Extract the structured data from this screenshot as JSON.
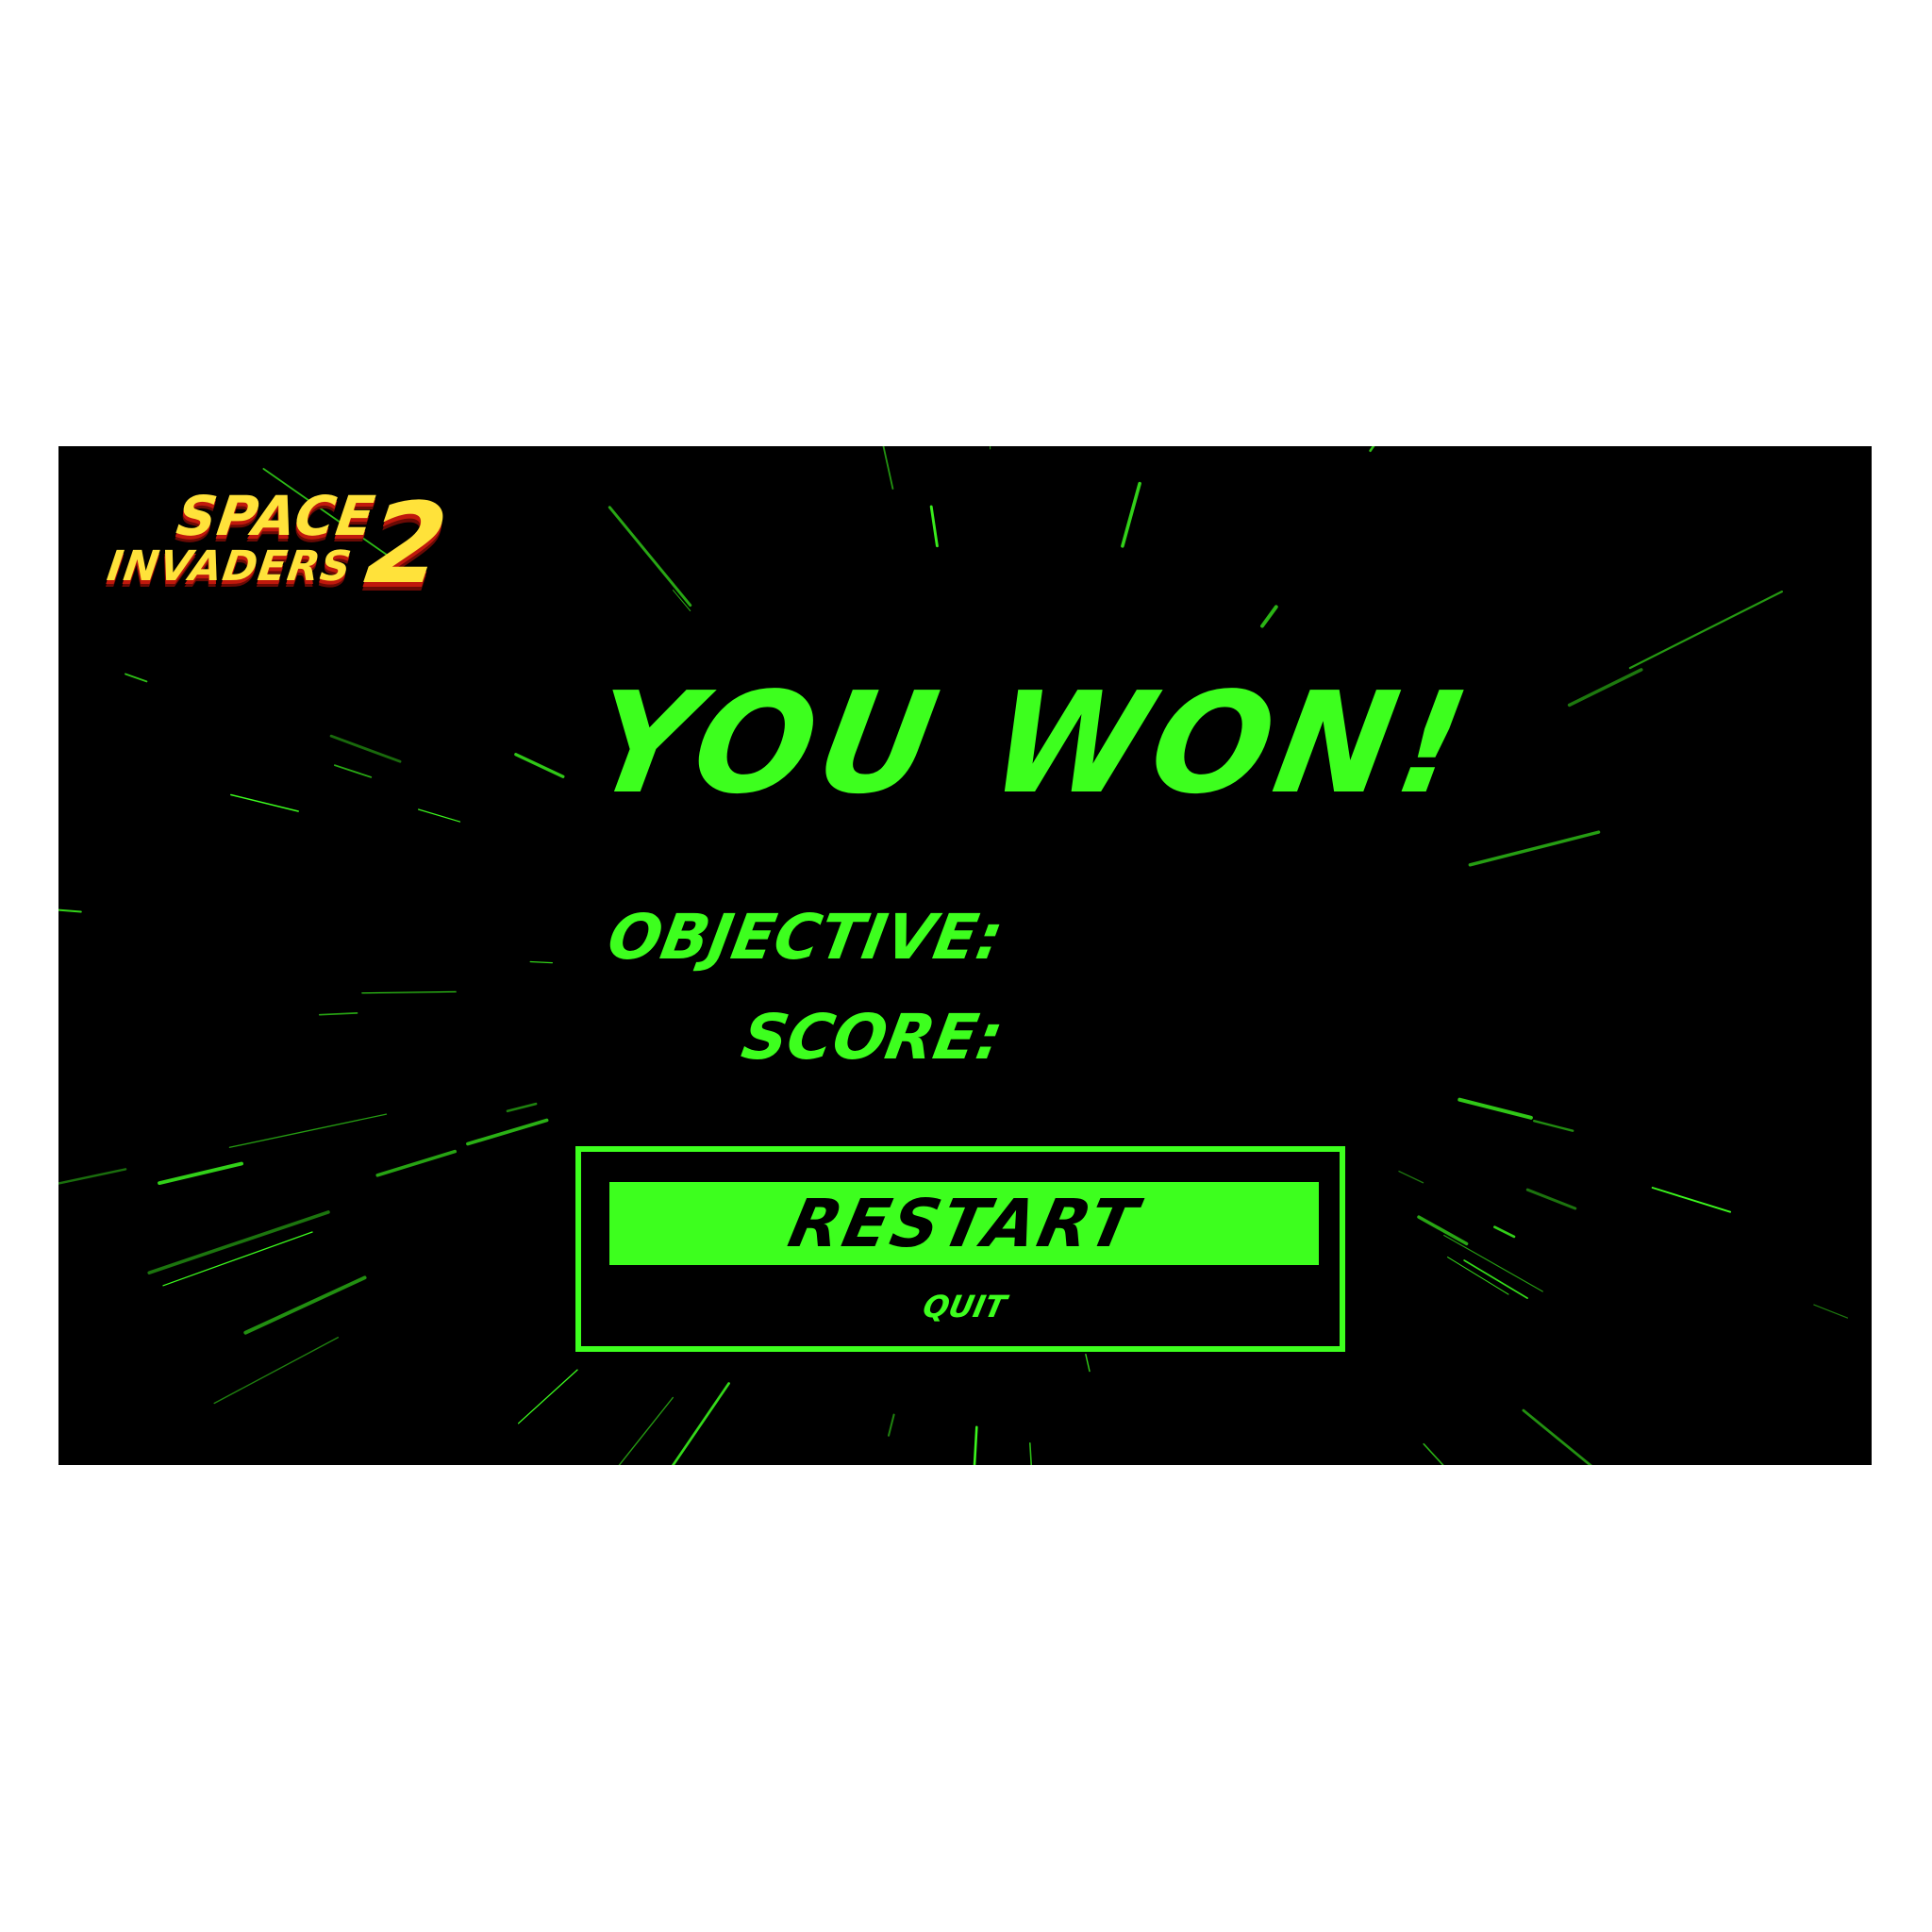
{
  "logo": {
    "line1": "SPACE",
    "line2": "INVADERS",
    "number": "2"
  },
  "result": {
    "headline": "YOU WON!",
    "objective_label": "OBJECTIVE:",
    "score_label": "SCORE:"
  },
  "menu": {
    "restart_label": "RESTART",
    "quit_label": "QUIT",
    "selected": "RESTART"
  },
  "colors": {
    "accent": "#3dff1e",
    "background": "#000000",
    "logo_yellow": "#ffe23a",
    "logo_red": "#c0180c"
  }
}
